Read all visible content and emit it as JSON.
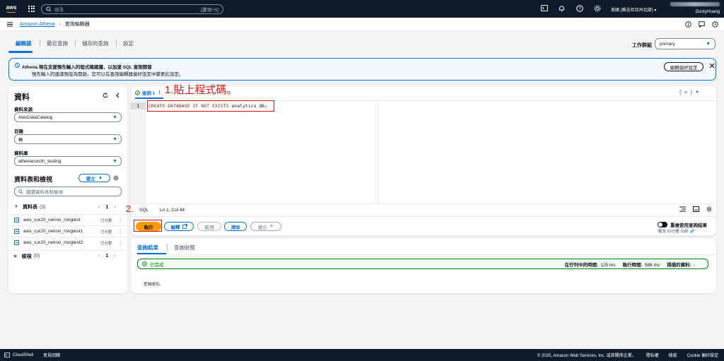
{
  "topnav": {
    "search_placeholder": "搜尋",
    "search_hint": "[選項+S]",
    "region": "美國 (維吉尼亞州北部)",
    "user_name": "DuckyHuang"
  },
  "breadcrumb": {
    "service": "Amazon Athena",
    "page": "查詢編輯器"
  },
  "tabs": [
    "編輯器",
    "最近查詢",
    "儲存的查詢",
    "設定"
  ],
  "workgroup": {
    "label": "工作群組",
    "value": "primary"
  },
  "banner": {
    "title": "Athena 現在支援預先輸入的程式碼建議，以加速 SQL 查詢開發",
    "text": "預先輸入的建議預設為開啟。您可以在查詢編輯器偏好設定中變更此設定。",
    "button": "編輯偏好設定"
  },
  "left": {
    "title": "資料",
    "datasource_label": "資料來源",
    "datasource": "AwsDataCatalog",
    "catalog_label": "目錄",
    "catalog": "無",
    "database_label": "資料庫",
    "database": "athenacurcfn_testing",
    "tables_views_title": "資料表和檢視",
    "create_btn": "建立",
    "filter_placeholder": "篩選資料表和檢視",
    "tables_label": "資料表",
    "tables_count": "(3)",
    "page": "1",
    "tables": [
      {
        "name": "aws_cur20_netron_rongtest",
        "partition": "已分割"
      },
      {
        "name": "aws_cur20_netron_rongtest1",
        "partition": "已分割"
      },
      {
        "name": "aws_cur20_netron_rongtest2",
        "partition": "已分割"
      }
    ],
    "views_label": "檢視",
    "views_count": "(0)",
    "views_page": "1"
  },
  "editor": {
    "tab_label": "查詢 1",
    "line_number": "1",
    "code_keyword": "CREATE DATABASE IF NOT EXISTS",
    "code_rest": " analytics_db;",
    "annotation1": "1.貼上程式碼。",
    "annotation2": "2.",
    "status_lang": "SQL",
    "status_pos": "Ln 1, Col 44",
    "btn_run": "執行",
    "btn_explain": "解釋",
    "btn_cancel": "取消",
    "btn_clear": "清除",
    "btn_create": "建立",
    "reuse_label": "重複使用查詢結果",
    "reuse_sub": "截至 60分鐘 以前"
  },
  "results": {
    "tabs": [
      "查詢結果",
      "查詢狀態"
    ],
    "status": "已完成",
    "queue_time_label": "在佇列中的時間:",
    "queue_time": "125 ms",
    "run_time_label": "執行時間:",
    "run_time": "588 ms",
    "scanned_label": "掃描的資料:",
    "scanned": "-",
    "message": "查詢成功。"
  },
  "footer": {
    "cloudshell": "CloudShell",
    "feedback": "意見回饋",
    "copyright": "© 2025, Amazon Web Services, Inc. 或其關係企業。",
    "privacy": "隱私權",
    "terms": "條款",
    "cookies": "Cookie 偏好設定"
  }
}
